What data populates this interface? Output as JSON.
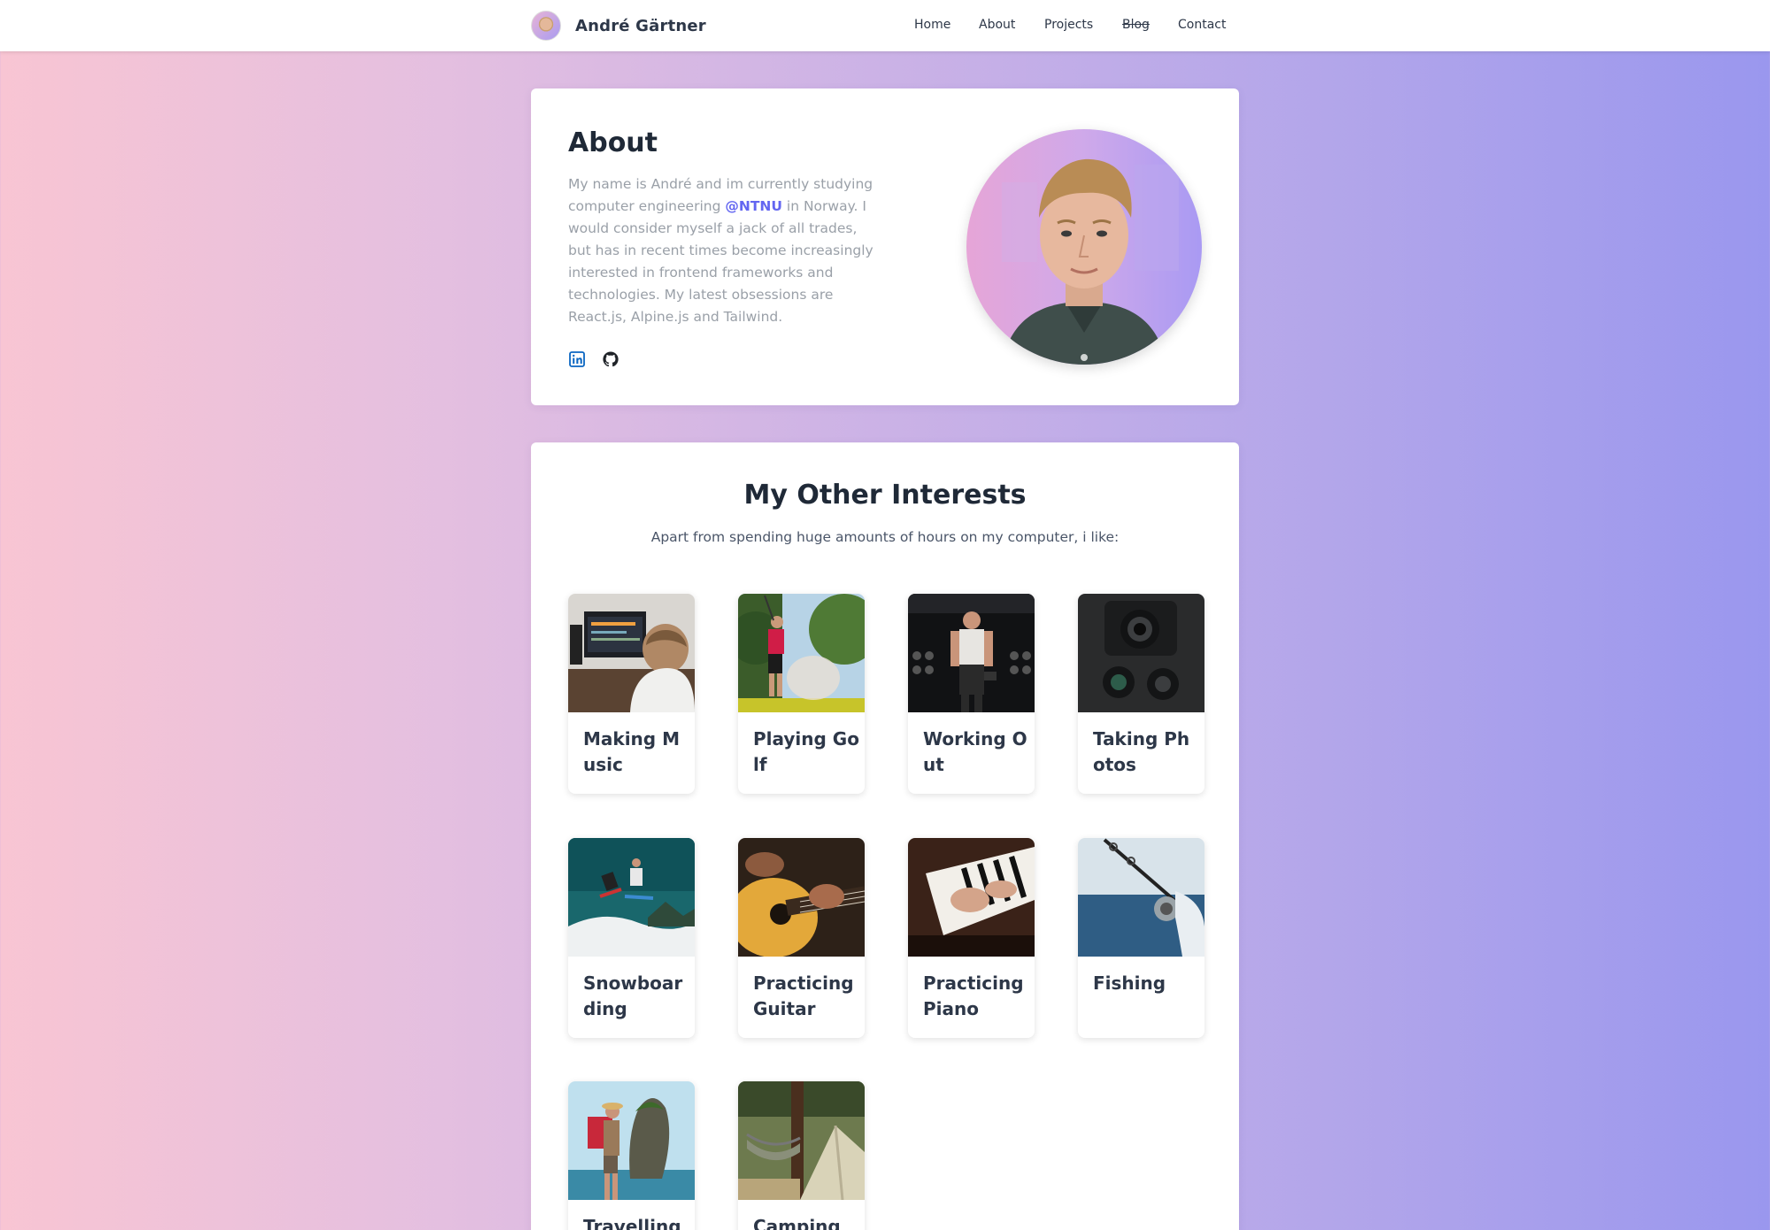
{
  "nav": {
    "brand_name": "André Gärtner",
    "links": [
      {
        "label": "Home",
        "struck": false
      },
      {
        "label": "About",
        "struck": false
      },
      {
        "label": "Projects",
        "struck": false
      },
      {
        "label": "Blog",
        "struck": true
      },
      {
        "label": "Contact",
        "struck": false
      }
    ]
  },
  "about": {
    "title": "About",
    "text_before": "My name is André and im currently studying computer engineering ",
    "link_text": "@NTNU",
    "text_after": " in Norway. I would consider myself a jack of all trades, but has in recent times become increasingly interested in frontend frameworks and technologies. My latest obsessions are React.js, Alpine.js and Tailwind.",
    "social_icons": [
      "linkedin-icon",
      "github-icon"
    ]
  },
  "interests": {
    "title": "My Other Interests",
    "subtitle": "Apart from spending huge amounts of hours on my computer, i like:",
    "items": [
      {
        "label": "Making Music",
        "image": "music-studio-photo"
      },
      {
        "label": "Playing Golf",
        "image": "golf-swing-photo"
      },
      {
        "label": "Working Out",
        "image": "gym-photo"
      },
      {
        "label": "Taking Photos",
        "image": "camera-photo"
      },
      {
        "label": "Snowboarding",
        "image": "snowboard-photo"
      },
      {
        "label": "Practicing Guitar",
        "image": "guitar-photo"
      },
      {
        "label": "Practicing Piano",
        "image": "piano-photo"
      },
      {
        "label": "Fishing",
        "image": "fishing-photo"
      },
      {
        "label": "Travelling",
        "image": "travel-photo"
      },
      {
        "label": "Camping",
        "image": "camping-photo"
      }
    ]
  },
  "colors": {
    "accent": "#6366f1",
    "linkedin": "#0a66c2",
    "text_dark": "#1f2937",
    "text_muted": "#9aa0a8"
  }
}
